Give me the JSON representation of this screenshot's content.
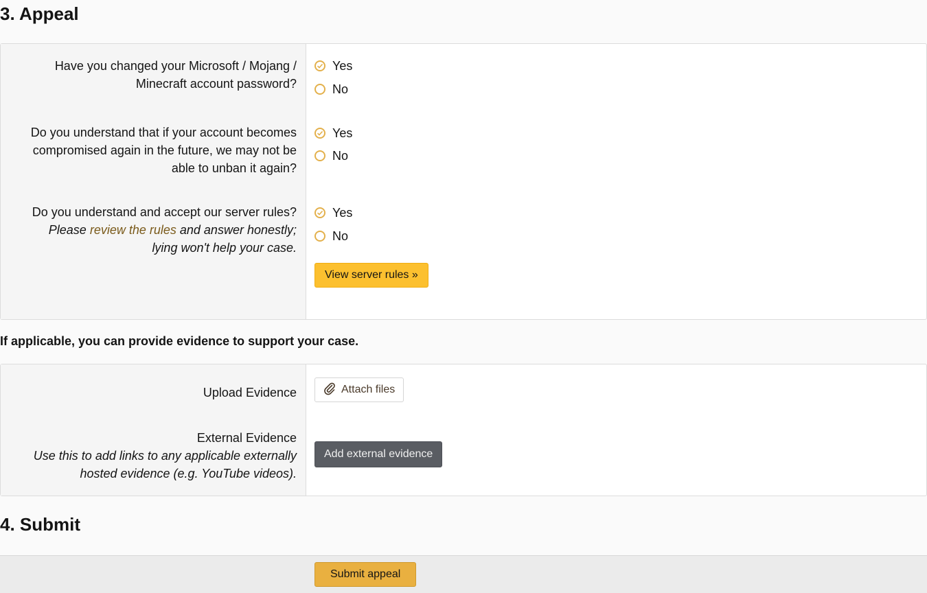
{
  "colors": {
    "accent": "#fcc02f",
    "radio_border": "#e3b04b",
    "submit_button": "#e9b040",
    "external_button": "#5a5d63",
    "link": "#7a5a1a"
  },
  "appeal": {
    "title": "3. Appeal",
    "questions": [
      {
        "label_line1": "Have you changed your Microsoft / Mojang /",
        "label_line2": "Minecraft account password?",
        "options": [
          "Yes",
          "No"
        ],
        "selected": "Yes"
      },
      {
        "label_line1": "Do you understand that if your account becomes",
        "label_line2": "compromised again in the future, we may not be",
        "label_line3": "able to unban it again?",
        "options": [
          "Yes",
          "No"
        ],
        "selected": "Yes"
      },
      {
        "label": "Do you understand and accept our server rules?",
        "hint_prefix": "Please ",
        "hint_link": "review the rules",
        "hint_suffix": " and answer honestly;",
        "hint_line2": "lying won't help your case.",
        "options": [
          "Yes",
          "No"
        ],
        "selected": "Yes"
      }
    ],
    "view_rules_button": "View server rules »"
  },
  "evidence": {
    "intro": "If applicable, you can provide evidence to support your case.",
    "upload_label": "Upload Evidence",
    "attach_button": "Attach files",
    "attach_icon": "paperclip-icon",
    "external_label": "External Evidence",
    "external_hint_line1": "Use this to add links to any applicable externally",
    "external_hint_line2": "hosted evidence (e.g. YouTube videos).",
    "external_button": "Add external evidence"
  },
  "submit": {
    "title": "4. Submit",
    "button": "Submit appeal"
  }
}
